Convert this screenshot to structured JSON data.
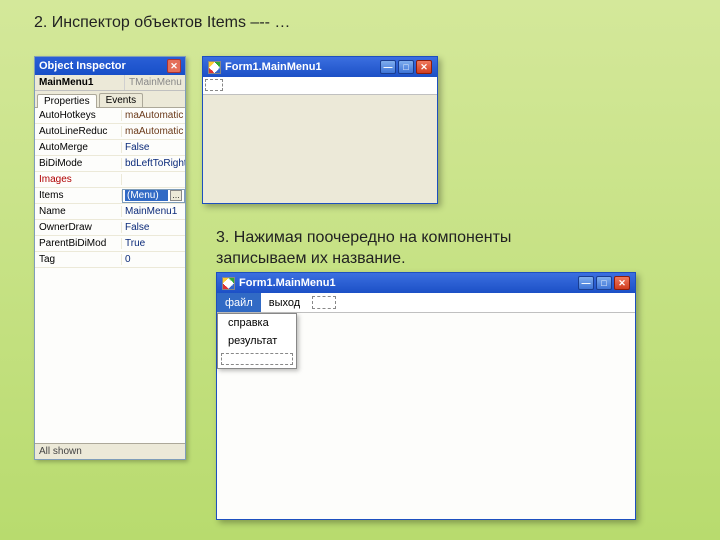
{
  "steps": {
    "s2": "2. Инспектор объектов Items –-- …",
    "s3": "3. Нажимая поочередно на компоненты записываем  их название."
  },
  "inspector": {
    "title": "Object Inspector",
    "combo_name": "MainMenu1",
    "combo_type": "TMainMenu",
    "tab1": "Properties",
    "tab2": "Events",
    "rows": [
      {
        "name": "AutoHotkeys",
        "value": "maAutomatic",
        "cls": "val-brown"
      },
      {
        "name": "AutoLineReduc",
        "value": "maAutomatic",
        "cls": "val-brown"
      },
      {
        "name": "AutoMerge",
        "value": "False",
        "cls": "val-navy"
      },
      {
        "name": "BiDiMode",
        "value": "bdLeftToRight",
        "cls": "val-navy"
      },
      {
        "name": "Images",
        "value": "",
        "cls": "val-red",
        "redname": true
      }
    ],
    "sel": {
      "name": "Items",
      "value": "(Menu)"
    },
    "rows2": [
      {
        "name": "Name",
        "value": "MainMenu1",
        "cls": "val-navy"
      },
      {
        "name": "OwnerDraw",
        "value": "False",
        "cls": "val-navy"
      },
      {
        "name": "ParentBiDiMod",
        "value": "True",
        "cls": "val-navy"
      },
      {
        "name": "Tag",
        "value": "0",
        "cls": "val-navy"
      }
    ],
    "status": "All shown"
  },
  "win_small": {
    "title": "Form1.MainMenu1"
  },
  "win_big": {
    "title": "Form1.MainMenu1",
    "menu": {
      "file": "файл",
      "exit": "выход"
    },
    "dropdown": [
      "справка",
      "результат"
    ]
  }
}
